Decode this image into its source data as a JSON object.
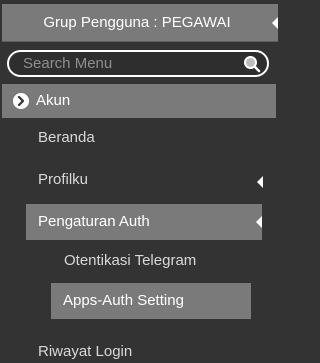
{
  "sidebar": {
    "group_header": {
      "label": "Grup Pengguna : PEGAWAI"
    },
    "search": {
      "placeholder": "Search Menu",
      "value": ""
    },
    "section": {
      "label": "Akun"
    },
    "items": [
      {
        "label": "Beranda"
      },
      {
        "label": "Profilku",
        "has_submenu": true
      },
      {
        "label": "Pengaturan Auth",
        "has_submenu": true,
        "expanded": true,
        "children": [
          {
            "label": "Otentikasi Telegram"
          },
          {
            "label": "Apps-Auth Setting",
            "active": true
          }
        ]
      },
      {
        "label": "Riwayat Login"
      }
    ]
  },
  "colors": {
    "background": "#333333",
    "highlight": "#7a7a7a",
    "text": "#d8d8d8",
    "text_active": "#ffffff"
  },
  "icons": {
    "search": "search-icon",
    "section": "chevron-right-circle-icon",
    "expand": "caret-left-icon"
  }
}
